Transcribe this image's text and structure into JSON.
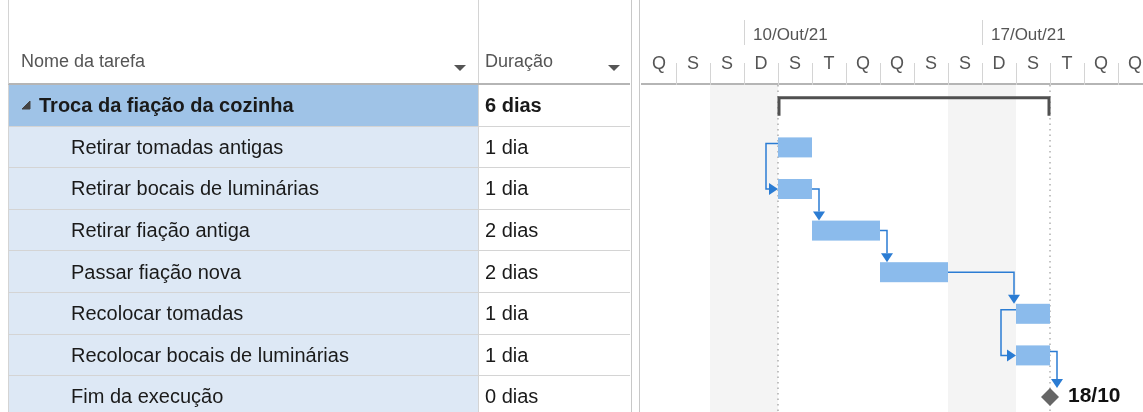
{
  "table": {
    "columns": [
      {
        "label": "Nome da tarefa"
      },
      {
        "label": "Duração"
      }
    ],
    "rows": [
      {
        "kind": "summary",
        "expanded": true,
        "selected": true,
        "name": "Troca da fiação da cozinha",
        "duration": "6 dias"
      },
      {
        "kind": "task",
        "selected": false,
        "name": "Retirar tomadas antigas",
        "duration": "1 dia"
      },
      {
        "kind": "task",
        "selected": false,
        "name": "Retirar bocais de luminárias",
        "duration": "1 dia"
      },
      {
        "kind": "task",
        "selected": false,
        "name": "Retirar fiação antiga",
        "duration": "2 dias"
      },
      {
        "kind": "task",
        "selected": false,
        "name": "Passar fiação nova",
        "duration": "2 dias"
      },
      {
        "kind": "task",
        "selected": false,
        "name": "Recolocar tomadas",
        "duration": "1 dia"
      },
      {
        "kind": "task",
        "selected": false,
        "name": "Recolocar bocais de luminárias",
        "duration": "1 dia"
      },
      {
        "kind": "milestone",
        "selected": false,
        "name": "Fim da execução",
        "duration": "0 dias",
        "date_label": "18/10"
      }
    ]
  },
  "timeline": {
    "weeks": [
      {
        "label": "10/Out/21"
      },
      {
        "label": "17/Out/21"
      }
    ],
    "days": [
      {
        "label": "Q",
        "weekend": false
      },
      {
        "label": "S",
        "weekend": false
      },
      {
        "label": "S",
        "weekend": true
      },
      {
        "label": "D",
        "weekend": true
      },
      {
        "label": "S",
        "weekend": false
      },
      {
        "label": "T",
        "weekend": false
      },
      {
        "label": "Q",
        "weekend": false
      },
      {
        "label": "Q",
        "weekend": false
      },
      {
        "label": "S",
        "weekend": false
      },
      {
        "label": "S",
        "weekend": true
      },
      {
        "label": "D",
        "weekend": true
      },
      {
        "label": "S",
        "weekend": false
      },
      {
        "label": "T",
        "weekend": false
      },
      {
        "label": "Q",
        "weekend": false
      },
      {
        "label": "Q",
        "weekend": false
      }
    ]
  }
}
